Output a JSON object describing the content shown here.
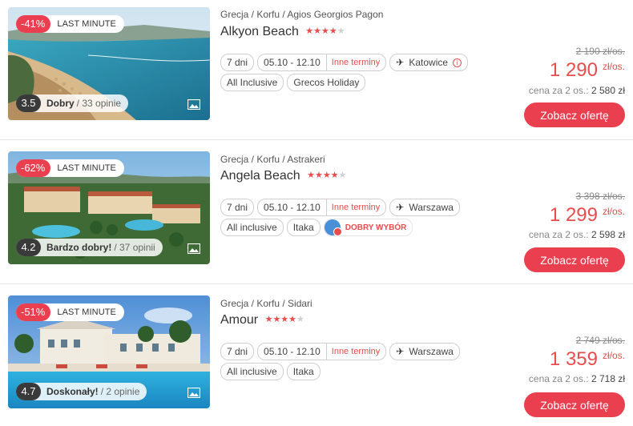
{
  "colors": {
    "accent": "#ea3f4f",
    "star": "#e84c4c",
    "border": "#cfcfcf"
  },
  "offers": [
    {
      "discount": "-41%",
      "badge": "LAST MINUTE",
      "score": "3.5",
      "score_word": "Dobry",
      "reviews": "/ 33 opinie",
      "breadcrumb": "Grecja / Korfu / Agios Georgios Pagon",
      "name": "Alkyon Beach",
      "stars": 4,
      "duration": "7 dni",
      "dates": "05.10 - 12.10",
      "other_terms": "Inne terminy",
      "departure": "Katowice",
      "board": "All Inclusive",
      "operator": "Grecos Holiday",
      "old_price": "2 190 zł/os.",
      "price": "1 290",
      "price_unit": "zł/os.",
      "per_two_label": "cena za 2 os.:",
      "per_two_value": "2 580 zł",
      "cta": "Zobacz ofertę"
    },
    {
      "discount": "-62%",
      "badge": "LAST MINUTE",
      "score": "4.2",
      "score_word": "Bardzo dobry!",
      "reviews": "/ 37 opinii",
      "breadcrumb": "Grecja / Korfu / Astrakeri",
      "name": "Angela Beach",
      "stars": 4,
      "duration": "7 dni",
      "dates": "05.10 - 12.10",
      "other_terms": "Inne terminy",
      "departure": "Warszawa",
      "board": "All inclusive",
      "operator": "Itaka",
      "choice": "DOBRY WYBÓR",
      "old_price": "3 398 zł/os.",
      "price": "1 299",
      "price_unit": "zł/os.",
      "per_two_label": "cena za 2 os.:",
      "per_two_value": "2 598 zł",
      "cta": "Zobacz ofertę"
    },
    {
      "discount": "-51%",
      "badge": "LAST MINUTE",
      "score": "4.7",
      "score_word": "Doskonały!",
      "reviews": "/ 2 opinie",
      "breadcrumb": "Grecja / Korfu / Sidari",
      "name": "Amour",
      "stars": 4,
      "duration": "7 dni",
      "dates": "05.10 - 12.10",
      "other_terms": "Inne terminy",
      "departure": "Warszawa",
      "board": "All inclusive",
      "operator": "Itaka",
      "old_price": "2 749 zł/os.",
      "price": "1 359",
      "price_unit": "zł/os.",
      "per_two_label": "cena za 2 os.:",
      "per_two_value": "2 718 zł",
      "cta": "Zobacz ofertę"
    }
  ]
}
